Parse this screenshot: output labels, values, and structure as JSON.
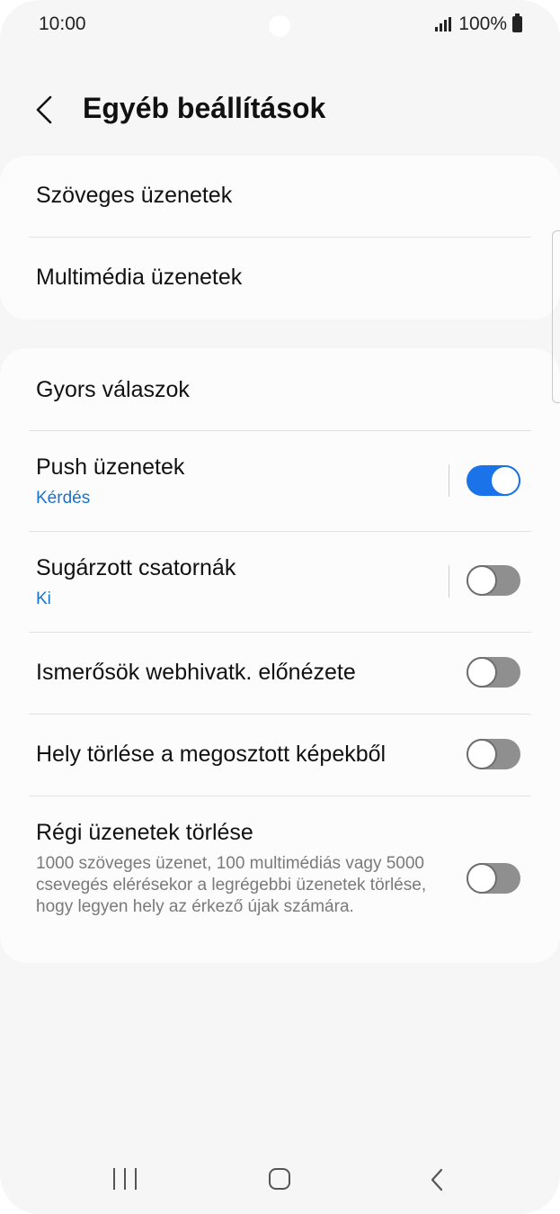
{
  "status": {
    "time": "10:00",
    "battery": "100%"
  },
  "header": {
    "title": "Egyéb beállítások"
  },
  "sections": [
    {
      "items": [
        {
          "title": "Szöveges üzenetek"
        },
        {
          "title": "Multimédia üzenetek"
        }
      ]
    },
    {
      "items": [
        {
          "title": "Gyors válaszok"
        },
        {
          "title": "Push üzenetek",
          "subtitle": "Kérdés",
          "toggle_on": true
        },
        {
          "title": "Sugárzott csatornák",
          "subtitle": "Ki",
          "toggle_on": false
        },
        {
          "title": "Ismerősök webhivatk. előnézete",
          "toggle_on": false
        },
        {
          "title": "Hely törlése a megosztott képekből",
          "toggle_on": false
        },
        {
          "title": "Régi üzenetek törlése",
          "description": "1000 szöveges üzenet, 100 multimédiás vagy 5000 csevegés elérésekor a legrégebbi üzenetek törlése, hogy legyen hely az érkező újak számára.",
          "toggle_on": false
        }
      ]
    }
  ],
  "colors": {
    "accent": "#1a73e8",
    "subtitle": "#1a73c8",
    "background": "#f6f6f6",
    "card": "#fcfcfc"
  },
  "icons": {
    "back": "chevron-left-icon",
    "nav_recents": "recents-icon",
    "nav_home": "home-icon",
    "nav_back": "back-icon"
  }
}
